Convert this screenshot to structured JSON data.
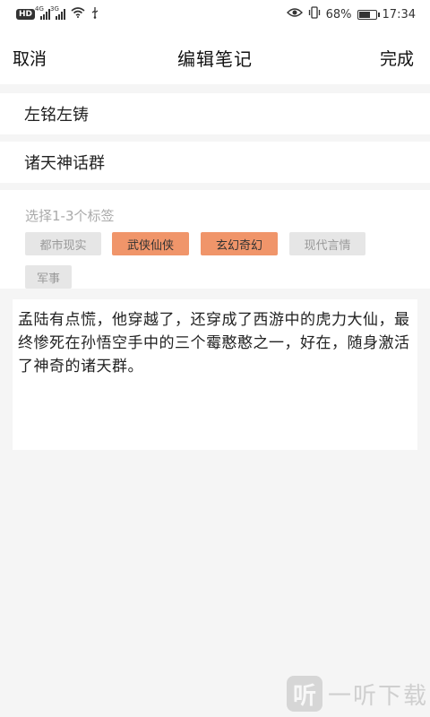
{
  "status_bar": {
    "carrier_badge": "HD",
    "net1": "4G",
    "net2": "3G",
    "battery_pct": "68%",
    "battery_level": 0.68,
    "time": "17:34"
  },
  "nav": {
    "cancel_label": "取消",
    "title": "编辑笔记",
    "done_label": "完成"
  },
  "fields": {
    "author": "左铭左铸",
    "group": "诸天神话群"
  },
  "tags": {
    "hint": "选择1-3个标签",
    "items": [
      {
        "label": "都市现实",
        "selected": false
      },
      {
        "label": "武侠仙侠",
        "selected": true
      },
      {
        "label": "玄幻奇幻",
        "selected": true
      },
      {
        "label": "现代言情",
        "selected": false
      },
      {
        "label": "军事",
        "selected": false
      }
    ],
    "selected_color": "#f0956a",
    "unselected_color": "#e6e6e6"
  },
  "content": {
    "text": "孟陆有点慌，他穿越了，还穿成了西游中的虎力大仙，最终惨死在孙悟空手中的三个霉憨憨之一，好在，随身激活了神奇的诸天群。"
  },
  "watermark": {
    "logo_char": "听",
    "text": "一听下载"
  }
}
